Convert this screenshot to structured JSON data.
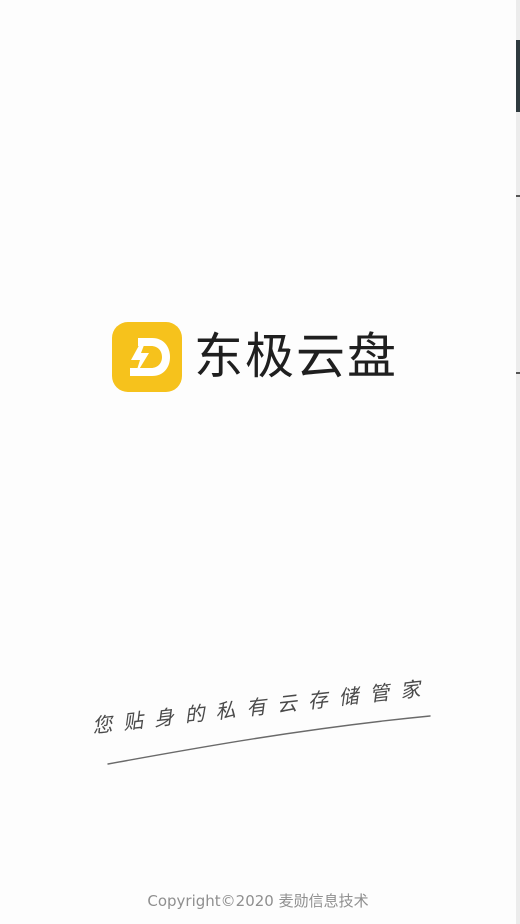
{
  "app": {
    "name": "东极云盘",
    "logo_icon": "lightning-d-logo-icon",
    "logo_color": "#F6C21C"
  },
  "slogan": {
    "text": "您贴身的私有云存储管家"
  },
  "footer": {
    "copyright": "Copyright©2020 麦勋信息技术"
  }
}
